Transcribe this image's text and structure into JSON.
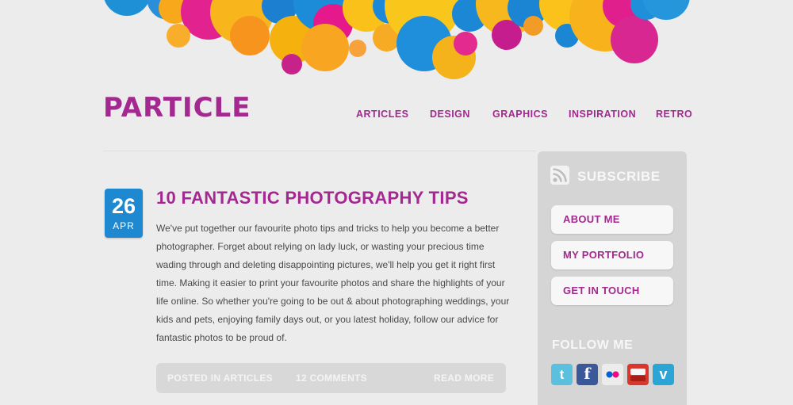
{
  "header": {
    "logo": "PARTICLE",
    "nav": [
      "ARTICLES",
      "DESIGN",
      "GRAPHICS",
      "INSPIRATION",
      "RETRO"
    ]
  },
  "post": {
    "date": {
      "day": "26",
      "month": "APR"
    },
    "title": "10 FANTASTIC PHOTOGRAPHY TIPS",
    "body": "We've put together our favourite photo tips and tricks to help you become a better photographer. Forget about relying on lady luck, or wasting your precious time wading through and deleting disappointing pictures, we'll help you get it right first time. Making it easier to print your favourite photos and share the highlights of your life online. So whether you're going to be out & about photographing weddings, your kids and pets, enjoying family days out, or you latest holiday, follow our advice for fantastic photos to be proud of.",
    "meta": {
      "posted_in": "POSTED IN ARTICLES",
      "comments": "12 COMMENTS",
      "read_more": "READ MORE"
    }
  },
  "sidebar": {
    "subscribe_label": "SUBSCRIBE",
    "links": [
      "ABOUT ME",
      "MY PORTFOLIO",
      "GET IN TOUCH"
    ],
    "follow_label": "FOLLOW ME",
    "social": [
      {
        "icon": "twitter-icon",
        "color": "#5bc0de"
      },
      {
        "icon": "facebook-icon",
        "color": "#3b5998"
      },
      {
        "icon": "flickr-icon",
        "color": "#ececec"
      },
      {
        "icon": "youtube-icon",
        "color": "#d9372b"
      },
      {
        "icon": "vimeo-icon",
        "color": "#2ba5d6"
      }
    ]
  },
  "colors": {
    "accent": "#a3288f",
    "date_badge": "#1e88d0",
    "background": "#ececec",
    "sidebar": "#d5d5d5"
  }
}
